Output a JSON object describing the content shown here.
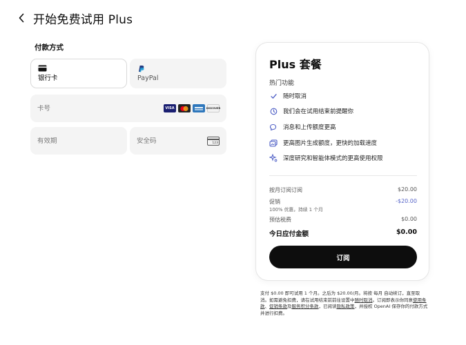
{
  "header": {
    "title": "开始免费试用 Plus",
    "back_icon": "chevron-left-icon"
  },
  "payment": {
    "section_label": "付款方式",
    "methods": [
      {
        "label": "银行卡",
        "icon": "credit-card-icon",
        "selected": true
      },
      {
        "label": "PayPal",
        "icon": "paypal-logo-icon",
        "selected": false
      }
    ],
    "card_number_placeholder": "卡号",
    "card_brands": [
      {
        "name": "VISA",
        "color": "#1a1f71"
      },
      {
        "name": "MC",
        "color": "#eb001b"
      },
      {
        "name": "AMEX",
        "color": "#2e77bc"
      },
      {
        "name": "DISCOVER",
        "color": "#f2f2f2"
      }
    ],
    "expiry_placeholder": "有效期",
    "cvc_placeholder": "安全码",
    "cvc_icon_text": "123"
  },
  "plan": {
    "title": "Plus 套餐",
    "features_heading": "热门功能",
    "features": [
      {
        "text": "随时取消",
        "icon": "check-icon"
      },
      {
        "text": "我们会在试用结束前提醒你",
        "icon": "clock-icon"
      },
      {
        "text": "消息和上传额度更高",
        "icon": "chat-bubbles-icon"
      },
      {
        "text": "更高图片生成额度，更快的加载速度",
        "icon": "images-icon"
      },
      {
        "text": "深度研究和智能体模式的更高使用权限",
        "icon": "sparkle-agent-icon"
      }
    ],
    "monthly_label": "按月订阅订阅",
    "monthly_value": "$20.00",
    "promo_label": "促销",
    "promo_value": "-$20.00",
    "promo_sub": "100% 优惠，持续 1 个月",
    "tax_label": "预估税费",
    "tax_value": "$0.00",
    "total_label": "今日应付金额",
    "total_value": "$0.00",
    "subscribe_label": "订阅",
    "discount_color": "#5563c7"
  },
  "disclaimer": {
    "part1": "支付 $0.00 即可试用 1 个月。之后为 $20.00/月。将按 每月 自动续订，直至取消。如需避免扣费，请在试用结束前前往设置中",
    "link_cancel": "随时取消",
    "part2": "。订阅即表示你同意",
    "link_terms": "使用条款",
    "sep1": "、",
    "link_promo": "促销条款",
    "sep2": "及",
    "link_service": "服务积分条款",
    "part3": "，已阅读",
    "link_privacy": "隐私政策",
    "part4": "，并授权 OpenAI 保存你的付款方式并进行扣费。"
  }
}
